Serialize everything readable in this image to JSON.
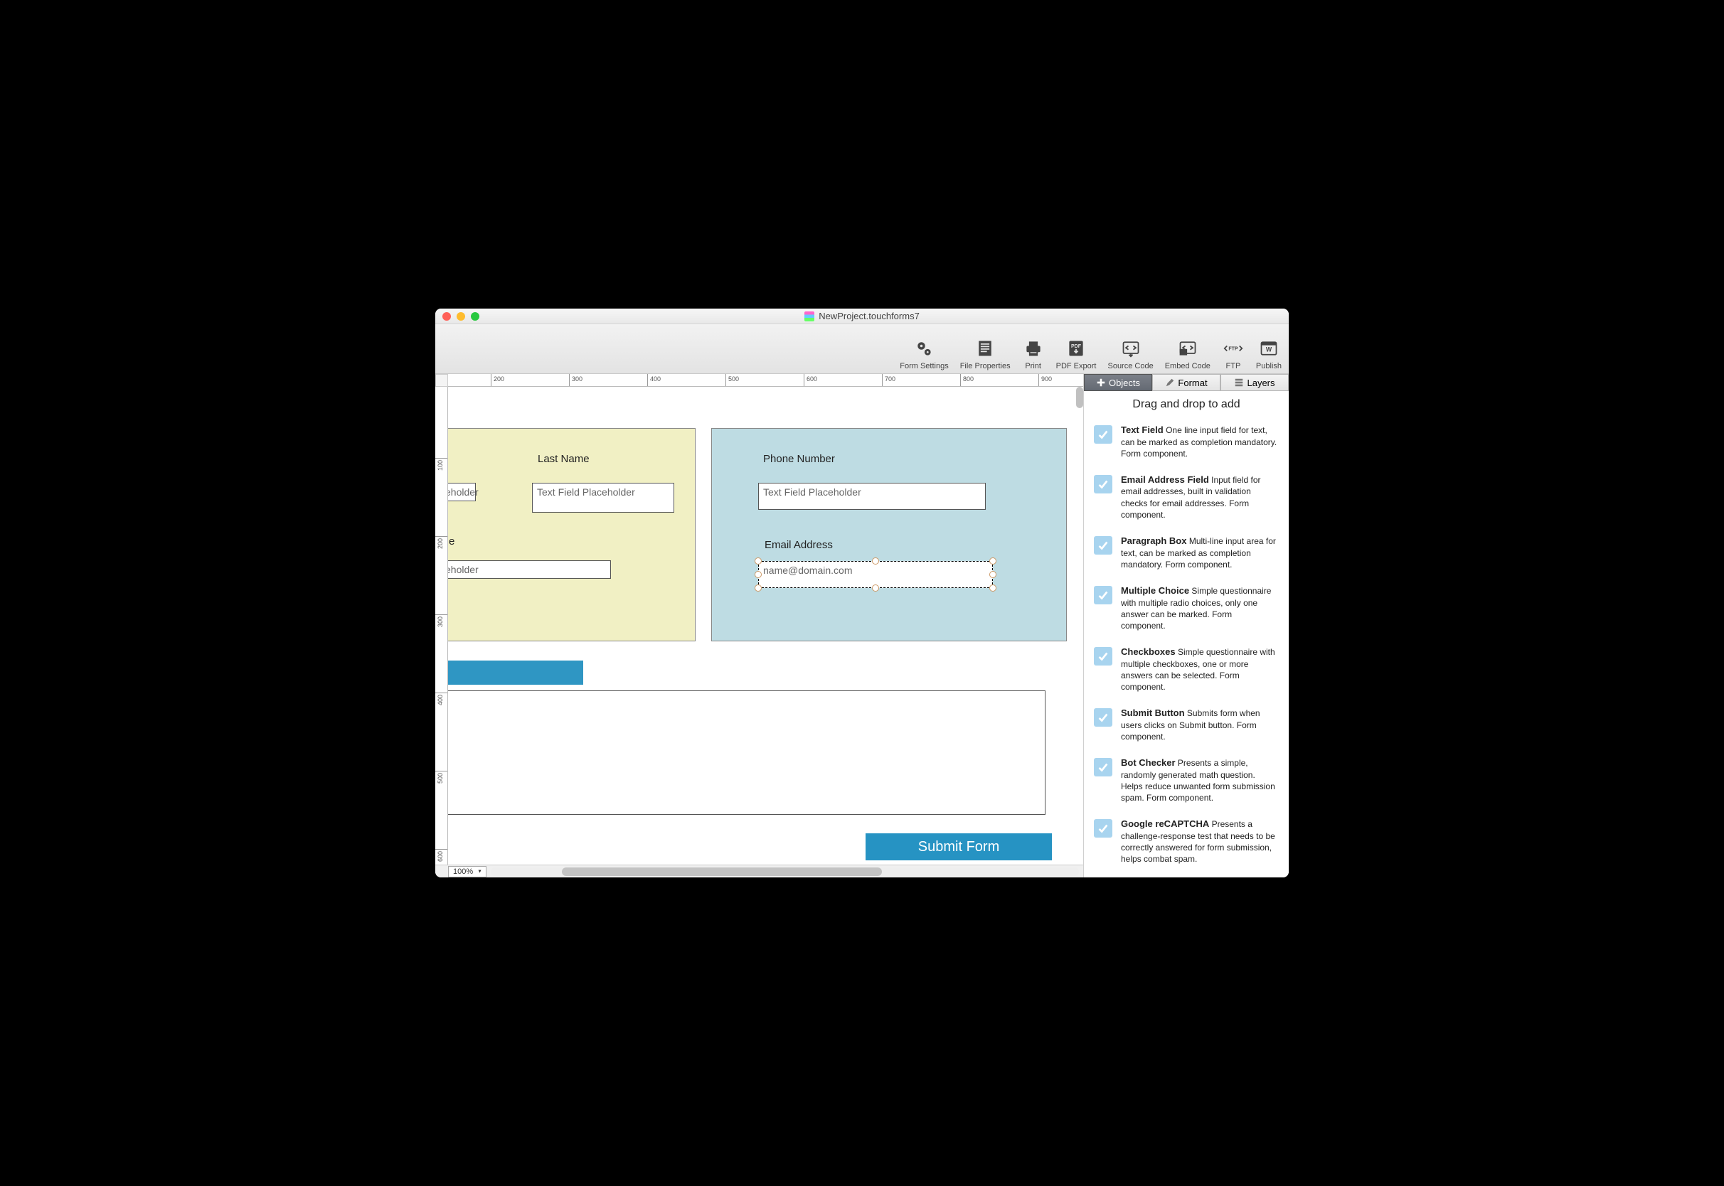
{
  "title": "NewProject.touchforms7",
  "toolbar": [
    {
      "label": "Form Settings",
      "name": "form-settings"
    },
    {
      "label": "File Properties",
      "name": "file-properties"
    },
    {
      "label": "Print",
      "name": "print"
    },
    {
      "label": "PDF Export",
      "name": "pdf-export"
    },
    {
      "label": "Source Code",
      "name": "source-code"
    },
    {
      "label": "Embed Code",
      "name": "embed-code"
    },
    {
      "label": "FTP",
      "name": "ftp"
    },
    {
      "label": "Publish",
      "name": "publish"
    }
  ],
  "ruler_h": [
    "200",
    "300",
    "400",
    "500",
    "600",
    "700",
    "800",
    "900"
  ],
  "ruler_v": [
    "100",
    "200",
    "300",
    "400",
    "500",
    "600"
  ],
  "canvas": {
    "last_name_label": "Last Name",
    "phone_label": "Phone Number",
    "email_label": "Email Address",
    "text_field_ph": "Text Field Placeholder",
    "eholder_frag": "eholder",
    "e_frag": "e",
    "email_ph": "name@domain.com",
    "submit_label": "Submit Form"
  },
  "zoom": "100%",
  "inspector": {
    "tabs": {
      "objects": "Objects",
      "format": "Format",
      "layers": "Layers"
    },
    "title": "Drag and drop to add",
    "items": [
      {
        "name": "Text Field",
        "desc": "One line input field for text, can be marked as completion mandatory.  Form component."
      },
      {
        "name": "Email Address Field",
        "desc": "Input field for email addresses, built in validation checks for email addresses.  Form component."
      },
      {
        "name": "Paragraph Box",
        "desc": "Multi-line input area for text, can be marked as completion mandatory.  Form component."
      },
      {
        "name": "Multiple Choice",
        "desc": "Simple questionnaire with multiple radio choices, only one answer can be marked.  Form component."
      },
      {
        "name": "Checkboxes",
        "desc": "Simple questionnaire with multiple checkboxes, one or more answers can be selected.  Form component."
      },
      {
        "name": "Submit Button",
        "desc": "Submits form when users clicks on Submit button.  Form component."
      },
      {
        "name": "Bot Checker",
        "desc": "Presents a simple, randomly generated math question.  Helps reduce unwanted form submission spam.  Form component."
      },
      {
        "name": "Google reCAPTCHA",
        "desc": "Presents a challenge-response test that needs to be correctly answered for form submission, helps combat spam."
      }
    ]
  }
}
